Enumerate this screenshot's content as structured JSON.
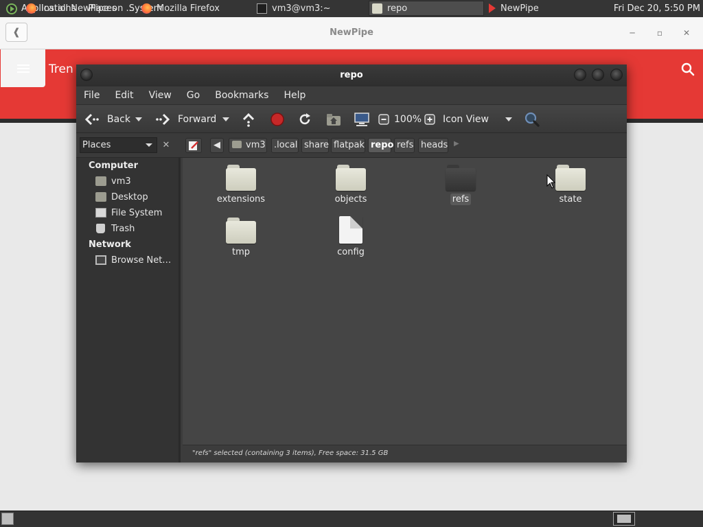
{
  "top_panel": {
    "menus": [
      "Applications",
      "Places",
      "System"
    ],
    "clock": "Fri Dec 20,  5:50 PM"
  },
  "newpipe": {
    "title": "NewPipe",
    "heading": "Tren",
    "accent": "#e53935"
  },
  "caja": {
    "title": "repo",
    "menu": [
      "File",
      "Edit",
      "View",
      "Go",
      "Bookmarks",
      "Help"
    ],
    "toolbar": {
      "back": "Back",
      "forward": "Forward",
      "zoom": "100%",
      "view_mode": "Icon View"
    },
    "places_select": "Places",
    "breadcrumbs": [
      "vm3",
      ".local",
      "share",
      "flatpak",
      "repo",
      "refs",
      "heads"
    ],
    "active_crumb": "repo",
    "sidebar": {
      "computer_heading": "Computer",
      "computer_items": [
        "vm3",
        "Desktop",
        "File System",
        "Trash"
      ],
      "network_heading": "Network",
      "network_items": [
        "Browse Net…"
      ]
    },
    "files": [
      {
        "name": "extensions",
        "type": "folder"
      },
      {
        "name": "objects",
        "type": "folder"
      },
      {
        "name": "refs",
        "type": "folder",
        "selected": true
      },
      {
        "name": "state",
        "type": "folder"
      },
      {
        "name": "tmp",
        "type": "folder"
      },
      {
        "name": "config",
        "type": "file"
      }
    ],
    "status": "\"refs\" selected (containing 3 items), Free space: 31.5 GB"
  },
  "taskbar": {
    "tasks": [
      "Install NewPipe on ...",
      "Mozilla Firefox",
      "vm3@vm3:~",
      "repo",
      "NewPipe"
    ],
    "active_task": "repo"
  }
}
